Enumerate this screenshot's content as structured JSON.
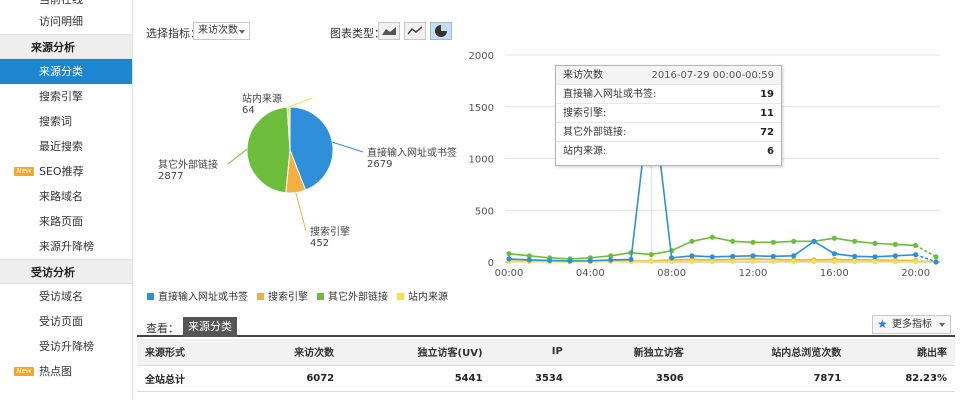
{
  "sidebar": {
    "items": [
      {
        "label": "当前在线",
        "type": "item"
      },
      {
        "label": "访问明细",
        "type": "item"
      },
      {
        "label": "来源分析",
        "type": "group"
      },
      {
        "label": "来源分类",
        "type": "item",
        "active": true
      },
      {
        "label": "搜索引擎",
        "type": "item"
      },
      {
        "label": "搜索词",
        "type": "item"
      },
      {
        "label": "最近搜索",
        "type": "item"
      },
      {
        "label": "SEO推荐",
        "type": "item",
        "badge": "New"
      },
      {
        "label": "来路域名",
        "type": "item"
      },
      {
        "label": "来路页面",
        "type": "item"
      },
      {
        "label": "来源升降榜",
        "type": "item"
      },
      {
        "label": "受访分析",
        "type": "group"
      },
      {
        "label": "受访域名",
        "type": "item"
      },
      {
        "label": "受访页面",
        "type": "item"
      },
      {
        "label": "受访升降榜",
        "type": "item"
      },
      {
        "label": "热点图",
        "type": "item",
        "badge": "New"
      }
    ]
  },
  "controls": {
    "metric_label": "选择指标：",
    "metric_value": "来访次数",
    "chart_type_label": "图表类型：",
    "chart_types": [
      "area-chart-icon",
      "line-chart-icon",
      "pie-chart-icon"
    ]
  },
  "pie": {
    "slices": [
      {
        "name": "直接输入网址或书签",
        "value": 2679,
        "color": "#2f8fd8"
      },
      {
        "name": "搜索引擎",
        "value": 452,
        "color": "#f2b043"
      },
      {
        "name": "其它外部链接",
        "value": 2877,
        "color": "#6dbd3c"
      },
      {
        "name": "站内来源",
        "value": 64,
        "color": "#f4e04a"
      }
    ],
    "labels": [
      {
        "name": "直接输入网址或书签",
        "value": "2679"
      },
      {
        "name": "搜索引擎",
        "value": "452"
      },
      {
        "name": "其它外部链接",
        "value": "2877"
      },
      {
        "name": "站内来源",
        "value": "64"
      }
    ]
  },
  "legend": [
    {
      "name": "直接输入网址或书签",
      "color": "#2f8fd8"
    },
    {
      "name": "搜索引擎",
      "color": "#f2b043"
    },
    {
      "name": "其它外部链接",
      "color": "#6dbd3c"
    },
    {
      "name": "站内来源",
      "color": "#f4e04a"
    }
  ],
  "chart_data": {
    "type": "line",
    "x": [
      "00:00",
      "01:00",
      "02:00",
      "03:00",
      "04:00",
      "05:00",
      "06:00",
      "07:00",
      "08:00",
      "09:00",
      "10:00",
      "11:00",
      "12:00",
      "13:00",
      "14:00",
      "15:00",
      "16:00",
      "17:00",
      "18:00",
      "19:00",
      "20:00",
      "21:00"
    ],
    "x_ticks": [
      "00:00",
      "04:00",
      "08:00",
      "12:00",
      "16:00",
      "20:00"
    ],
    "y_ticks": [
      "0",
      "500",
      "1000",
      "1500",
      "2000"
    ],
    "ylim": [
      0,
      2000
    ],
    "grid": true,
    "series": [
      {
        "name": "直接输入网址或书签",
        "color": "#2f8fd8",
        "values": [
          30,
          20,
          15,
          10,
          12,
          20,
          25,
          1700,
          40,
          60,
          50,
          55,
          60,
          55,
          60,
          200,
          80,
          55,
          50,
          60,
          70,
          0
        ]
      },
      {
        "name": "搜索引擎",
        "color": "#f2b043",
        "values": [
          10,
          8,
          5,
          4,
          5,
          8,
          10,
          11,
          20,
          25,
          20,
          25,
          30,
          25,
          20,
          20,
          25,
          20,
          20,
          15,
          15,
          0
        ]
      },
      {
        "name": "其它外部链接",
        "color": "#6dbd3c",
        "values": [
          80,
          60,
          40,
          30,
          40,
          60,
          90,
          72,
          110,
          200,
          240,
          200,
          190,
          190,
          200,
          200,
          230,
          200,
          180,
          170,
          160,
          50
        ]
      },
      {
        "name": "站内来源",
        "color": "#f4e04a",
        "values": [
          5,
          3,
          2,
          2,
          3,
          3,
          4,
          6,
          5,
          5,
          5,
          5,
          6,
          5,
          5,
          5,
          5,
          5,
          4,
          4,
          4,
          0
        ]
      }
    ]
  },
  "tooltip": {
    "title": "来访次数",
    "time": "2016-07-29 00:00-00:59",
    "rows": [
      {
        "name": "直接输入网址或书签:",
        "value": "19"
      },
      {
        "name": "搜索引擎:",
        "value": "11"
      },
      {
        "name": "其它外部链接:",
        "value": "72"
      },
      {
        "name": "站内来源:",
        "value": "6"
      }
    ]
  },
  "view": {
    "label": "查看：",
    "tab": "来源分类",
    "more": "更多指标"
  },
  "table": {
    "headers": [
      "来源形式",
      "来访次数",
      "独立访客(UV)",
      "IP",
      "新独立访客",
      "站内总浏览次数",
      "跳出率"
    ],
    "rows": [
      [
        "全站总计",
        "6072",
        "5441",
        "3534",
        "3506",
        "7871",
        "82.23%"
      ]
    ]
  }
}
